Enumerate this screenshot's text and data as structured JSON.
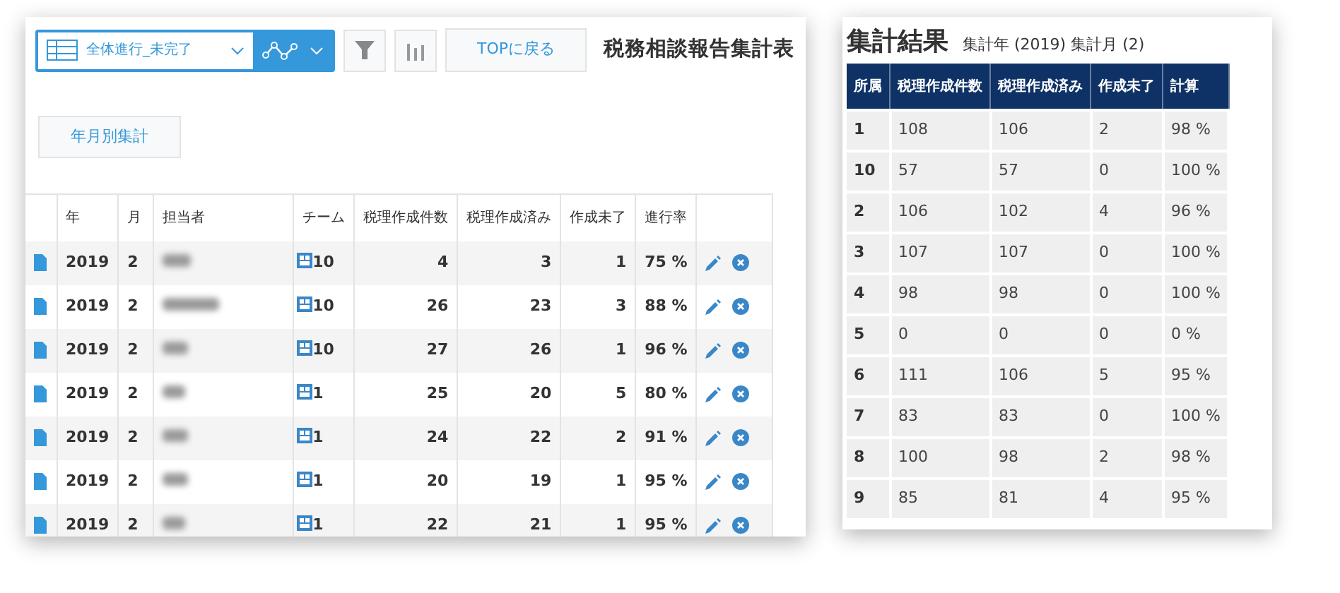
{
  "toolbar": {
    "view_select": "全体進行_未完了",
    "top_button": "TOPに戻る",
    "title": "税務相談報告集計表"
  },
  "summary_button": "年月別集計",
  "table": {
    "columns": [
      "年",
      "月",
      "担当者",
      "チーム",
      "税理作成件数",
      "税理作成済み",
      "作成未了",
      "進行率"
    ],
    "rows": [
      {
        "year": "2019",
        "month": "2",
        "team": "10",
        "total": "4",
        "done": "3",
        "pending": "1",
        "rate": "75 %"
      },
      {
        "year": "2019",
        "month": "2",
        "team": "10",
        "total": "26",
        "done": "23",
        "pending": "3",
        "rate": "88 %"
      },
      {
        "year": "2019",
        "month": "2",
        "team": "10",
        "total": "27",
        "done": "26",
        "pending": "1",
        "rate": "96 %"
      },
      {
        "year": "2019",
        "month": "2",
        "team": "1",
        "total": "25",
        "done": "20",
        "pending": "5",
        "rate": "80 %"
      },
      {
        "year": "2019",
        "month": "2",
        "team": "1",
        "total": "24",
        "done": "22",
        "pending": "2",
        "rate": "91 %"
      },
      {
        "year": "2019",
        "month": "2",
        "team": "1",
        "total": "20",
        "done": "19",
        "pending": "1",
        "rate": "95 %"
      },
      {
        "year": "2019",
        "month": "2",
        "team": "1",
        "total": "22",
        "done": "21",
        "pending": "1",
        "rate": "95 %"
      }
    ]
  },
  "results": {
    "title": "集計結果",
    "subtitle": "集計年 (2019) 集計月 (2)",
    "columns": [
      "所属",
      "税理作成件数",
      "税理作成済み",
      "作成未了",
      "計算"
    ],
    "rows": [
      [
        "1",
        "108",
        "106",
        "2",
        "98 %"
      ],
      [
        "10",
        "57",
        "57",
        "0",
        "100 %"
      ],
      [
        "2",
        "106",
        "102",
        "4",
        "96 %"
      ],
      [
        "3",
        "107",
        "107",
        "0",
        "100 %"
      ],
      [
        "4",
        "98",
        "98",
        "0",
        "100 %"
      ],
      [
        "5",
        "0",
        "0",
        "0",
        "0 %"
      ],
      [
        "6",
        "111",
        "106",
        "5",
        "95 %"
      ],
      [
        "7",
        "83",
        "83",
        "0",
        "100 %"
      ],
      [
        "8",
        "100",
        "98",
        "2",
        "98 %"
      ],
      [
        "9",
        "85",
        "81",
        "4",
        "95 %"
      ]
    ]
  }
}
